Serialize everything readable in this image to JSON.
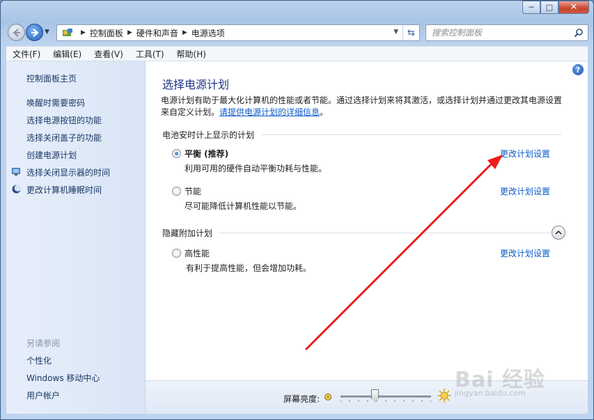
{
  "window": {
    "caption": {
      "minimize": "─",
      "maximize": "□",
      "close": "✕"
    }
  },
  "nav": {
    "breadcrumbs": [
      "控制面板",
      "硬件和声音",
      "电源选项"
    ],
    "search_placeholder": "搜索控制面板"
  },
  "menubar": {
    "items": [
      "文件(F)",
      "编辑(E)",
      "查看(V)",
      "工具(T)",
      "帮助(H)"
    ]
  },
  "sidebar": {
    "home": "控制面板主页",
    "links": [
      "唤醒时需要密码",
      "选择电源按钮的功能",
      "选择关闭盖子的功能",
      "创建电源计划",
      "选择关闭显示器的时间",
      "更改计算机睡眠时间"
    ],
    "see_also_title": "另请参阅",
    "see_also": [
      "个性化",
      "Windows 移动中心",
      "用户帐户"
    ]
  },
  "main": {
    "title": "选择电源计划",
    "description": "电源计划有助于最大化计算机的性能或者节能。通过选择计划来将其激活，或选择计划并通过更改其电源设置来自定义计划。",
    "description_link": "请提供电源计划的详细信息",
    "description_end": "。",
    "section_battery": "电池安时计上显示的计划",
    "section_hidden": "隐藏附加计划",
    "plans": [
      {
        "name": "平衡 (推荐)",
        "desc": "利用可用的硬件自动平衡功耗与性能。",
        "link": "更改计划设置",
        "selected": true
      },
      {
        "name": "节能",
        "desc": "尽可能降低计算机性能以节能。",
        "link": "更改计划设置",
        "selected": false
      },
      {
        "name": "高性能",
        "desc": "有利于提高性能，但会增加功耗。",
        "link": "更改计划设置",
        "selected": false
      }
    ],
    "help": "?"
  },
  "brightness": {
    "label": "屏幕亮度:",
    "level": 0.38
  },
  "watermark": {
    "brand": "Bai 经验",
    "url": "jingyan.baidu.com"
  },
  "colors": {
    "link": "#0b5bc8",
    "title": "#1e3287",
    "annotation_arrow": "#ee1c1c"
  }
}
